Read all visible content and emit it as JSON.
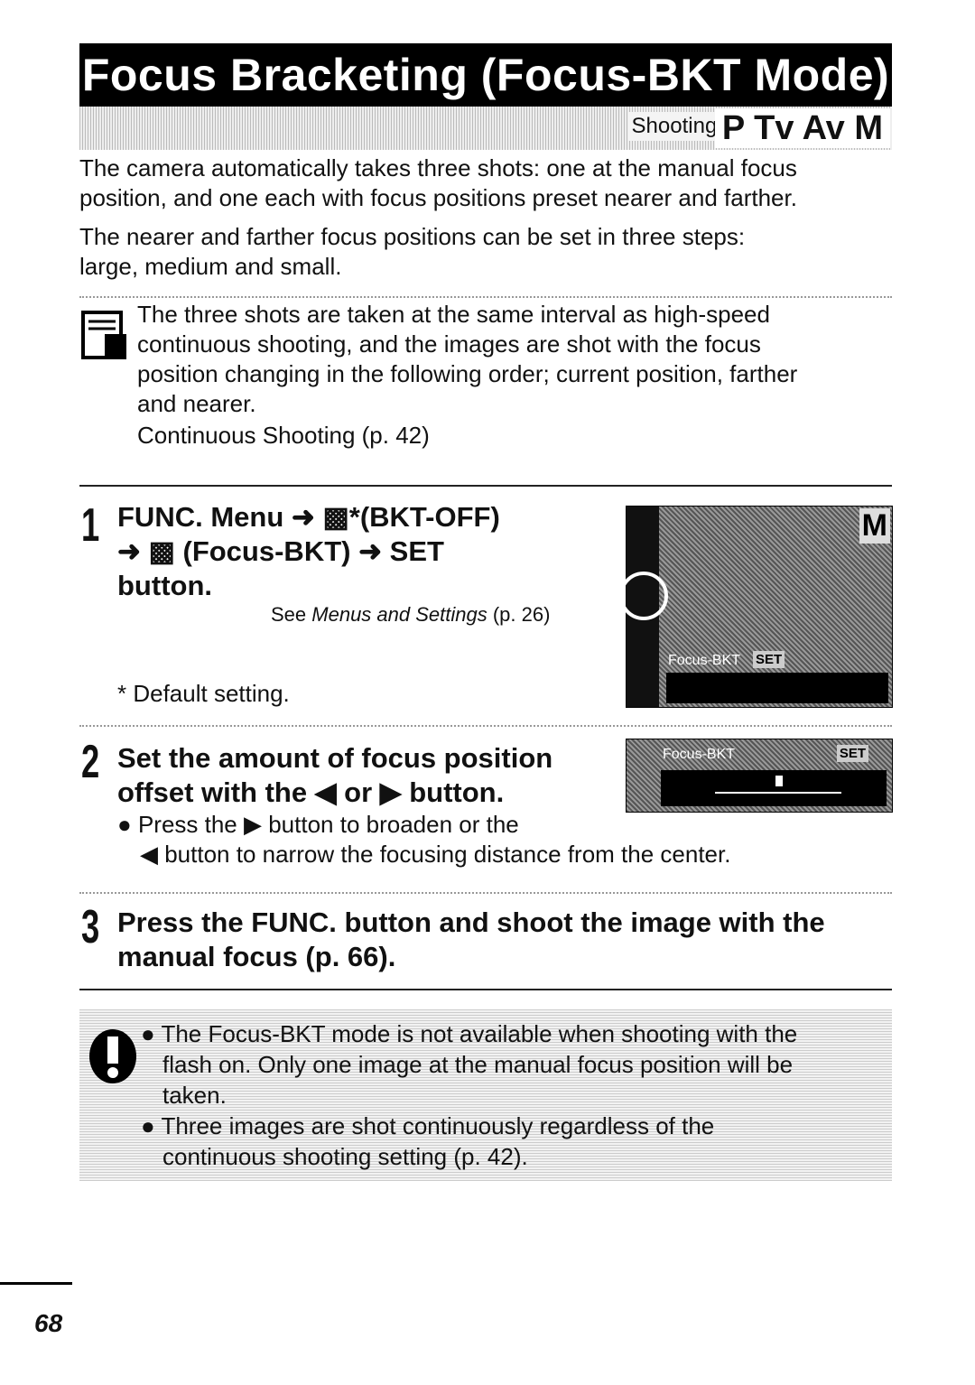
{
  "header": {
    "title": "Focus Bracketing (Focus-BKT Mode)",
    "shooting_mode_label": "Shooting Mode",
    "modes": "P Tv Av M"
  },
  "intro": {
    "p1": [
      "The camera automatically takes three shots: one at the manual focus",
      "position, and one each with focus positions preset nearer and farther."
    ],
    "p2": [
      "The nearer and farther focus positions can be set in three steps:",
      "large, medium and small."
    ]
  },
  "note": {
    "lines": [
      "The three shots are taken at the same interval as high-speed",
      "continuous shooting, and the images are shot with the focus",
      "position changing in the following order; current position, farther",
      "and nearer."
    ],
    "ref": "Continuous Shooting (p. 42)"
  },
  "step1": {
    "number": "1",
    "line1": "FUNC. Menu ➜ ▩*(BKT-OFF)",
    "line2": "➜ ▩ (Focus-BKT) ➜ SET",
    "line3": "button.",
    "see_prefix": "See ",
    "see_italic": "Menus and Settings",
    "see_suffix": " (p. 26)",
    "footnote": "* Default setting.",
    "screen": {
      "mode": "M",
      "label": "Focus-BKT",
      "set": "SET"
    }
  },
  "step2": {
    "number": "2",
    "line1": "Set the amount of focus position",
    "line2": "offset with the ◀ or ▶ button.",
    "bullet1": "Press the ▶ button to broaden or the",
    "bullet1b": "◀ button to narrow the focusing distance from the center.",
    "screen": {
      "label": "Focus-BKT",
      "set": "SET"
    }
  },
  "step3": {
    "number": "3",
    "line1": "Press the FUNC. button and shoot the image with the",
    "line2": "manual focus (p. 66)."
  },
  "caution": {
    "items": [
      [
        "The Focus-BKT mode is not available when shooting with the",
        "flash on. Only one image at the manual focus position will be",
        "taken."
      ],
      [
        "Three images are shot continuously regardless of the",
        "continuous shooting setting (p. 42)."
      ]
    ]
  },
  "footer": {
    "page_number": "68"
  }
}
